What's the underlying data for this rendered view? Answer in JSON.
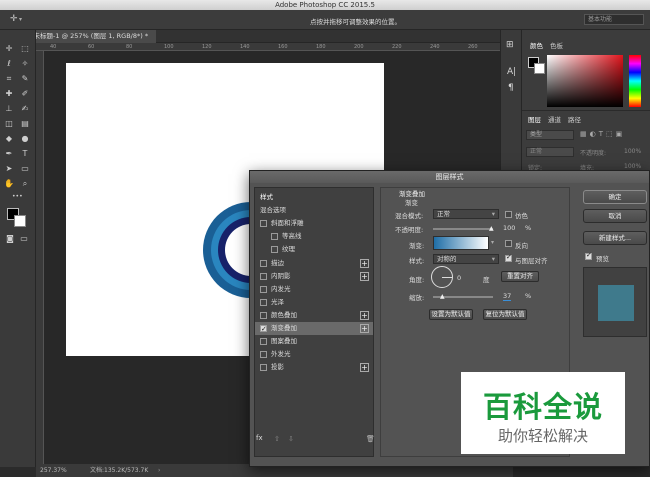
{
  "app": {
    "title": "Adobe Photoshop CC 2015.5",
    "hint": "点按并拖移可调整效果的位置。",
    "workspace": "基本功能"
  },
  "document": {
    "tab": "未标题-1 @ 257% (图层 1, RGB/8*) *",
    "ruler_ticks": [
      "40",
      "60",
      "80",
      "100",
      "120",
      "140",
      "160",
      "180",
      "200",
      "220",
      "240",
      "260"
    ]
  },
  "status": {
    "zoom": "257.37%",
    "doc": "文档:135.2K/573.7K"
  },
  "panels": {
    "color_tab": "颜色",
    "swatches_tab": "色板",
    "layers_tab": "图层",
    "channels_tab": "通道",
    "paths_tab": "路径",
    "kind": "类型",
    "mode": "正常",
    "opacity_label": "不透明度:",
    "opacity": "100%",
    "lock_label": "锁定:",
    "fill_label": "填充:",
    "fill": "100%"
  },
  "dialog": {
    "title": "图层样式",
    "styles": [
      {
        "label": "样式",
        "check": false,
        "plus": false,
        "active": false,
        "bold": true
      },
      {
        "label": "混合选项",
        "check": false,
        "plus": false,
        "active": false,
        "bold": false
      },
      {
        "label": "斜面和浮雕",
        "check": true,
        "on": false,
        "plus": false
      },
      {
        "label": "等高线",
        "check": true,
        "on": false,
        "plus": false,
        "indent": true
      },
      {
        "label": "纹理",
        "check": true,
        "on": false,
        "plus": false,
        "indent": true
      },
      {
        "label": "描边",
        "check": true,
        "on": false,
        "plus": true
      },
      {
        "label": "内阴影",
        "check": true,
        "on": false,
        "plus": true
      },
      {
        "label": "内发光",
        "check": true,
        "on": false,
        "plus": false
      },
      {
        "label": "光泽",
        "check": true,
        "on": false,
        "plus": false
      },
      {
        "label": "颜色叠加",
        "check": true,
        "on": false,
        "plus": true
      },
      {
        "label": "渐变叠加",
        "check": true,
        "on": true,
        "plus": true,
        "active": true
      },
      {
        "label": "图案叠加",
        "check": true,
        "on": false,
        "plus": false
      },
      {
        "label": "外发光",
        "check": true,
        "on": false,
        "plus": false
      },
      {
        "label": "投影",
        "check": true,
        "on": false,
        "plus": true
      }
    ],
    "section_title": "渐变叠加",
    "section_sub": "渐变",
    "blend_mode_label": "混合模式:",
    "blend_mode": "正常",
    "dither_label": "仿色",
    "opacity_label": "不透明度:",
    "opacity": "100",
    "pct": "%",
    "gradient_label": "渐变:",
    "reverse_label": "反向",
    "style_label": "样式:",
    "style": "对称的",
    "align_label": "与图层对齐",
    "angle_label": "角度:",
    "angle": "0",
    "degree": "度",
    "reset_align": "重置对齐",
    "scale_label": "缩放:",
    "scale": "37",
    "set_default": "设置为默认值",
    "reset_default": "复位为默认值",
    "ok": "确定",
    "cancel": "取消",
    "new_style": "新建样式...",
    "preview_label": "预览",
    "fx": "fx"
  },
  "watermark": {
    "title": "百科全说",
    "subtitle": "助你轻松解决"
  },
  "colors": {
    "accent": "#1f6ea6",
    "ring_dark": "#17226a",
    "preview": "#3f7a8c"
  }
}
